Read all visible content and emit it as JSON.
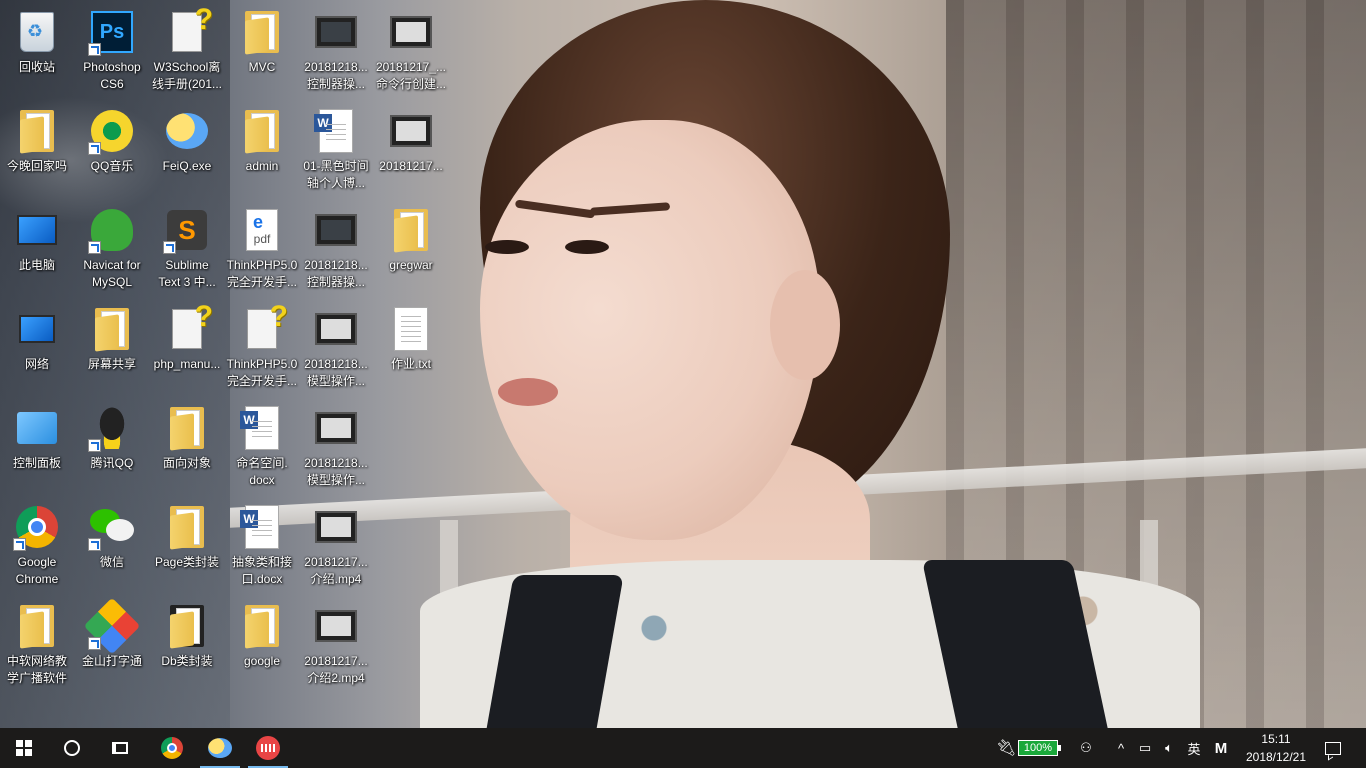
{
  "desktop": {
    "icons": [
      {
        "label": "回收站"
      },
      {
        "label": "Photoshop\nCS6"
      },
      {
        "label": "W3School离\n线手册(201..."
      },
      {
        "label": "MVC"
      },
      {
        "label": "20181218...\n控制器操..."
      },
      {
        "label": "20181217_...\n命令行创建..."
      },
      {
        "label": "今晚回家吗"
      },
      {
        "label": "QQ音乐"
      },
      {
        "label": "FeiQ.exe"
      },
      {
        "label": "admin"
      },
      {
        "label": "01-黑色时间\n轴个人博..."
      },
      {
        "label": "20181217..."
      },
      {
        "label": "此电脑"
      },
      {
        "label": "Navicat for\nMySQL"
      },
      {
        "label": "Sublime\nText 3 中..."
      },
      {
        "label": "ThinkPHP5.0\n完全开发手..."
      },
      {
        "label": "20181218...\n控制器操..."
      },
      {
        "label": "gregwar"
      },
      {
        "label": "网络"
      },
      {
        "label": "屏幕共享"
      },
      {
        "label": "php_manu..."
      },
      {
        "label": "ThinkPHP5.0\n完全开发手..."
      },
      {
        "label": "20181218...\n模型操作..."
      },
      {
        "label": "作业.txt"
      },
      {
        "label": "控制面板"
      },
      {
        "label": "腾讯QQ"
      },
      {
        "label": "面向对象"
      },
      {
        "label": "命名空间.\ndocx"
      },
      {
        "label": "20181218...\n模型操作..."
      },
      {
        "label": "Google\nChrome"
      },
      {
        "label": "微信"
      },
      {
        "label": "Page类封装"
      },
      {
        "label": "抽象类和接\n口.docx"
      },
      {
        "label": "20181217...\n介绍.mp4"
      },
      {
        "label": "中软网络教\n学广播软件"
      },
      {
        "label": "金山打字通"
      },
      {
        "label": "Db类封装"
      },
      {
        "label": "google"
      },
      {
        "label": "20181217...\n介绍2.mp4"
      }
    ]
  },
  "taskbar": {
    "pdf_label": "pdf",
    "battery_percent": "100%",
    "ime_label": "英",
    "ime_mode": "M",
    "time": "15:11",
    "date": "2018/12/21"
  },
  "colors": {
    "taskbar_bg": "#1c1b1a",
    "battery_green": "#1aa83a",
    "active_indicator": "#76b9ed"
  }
}
